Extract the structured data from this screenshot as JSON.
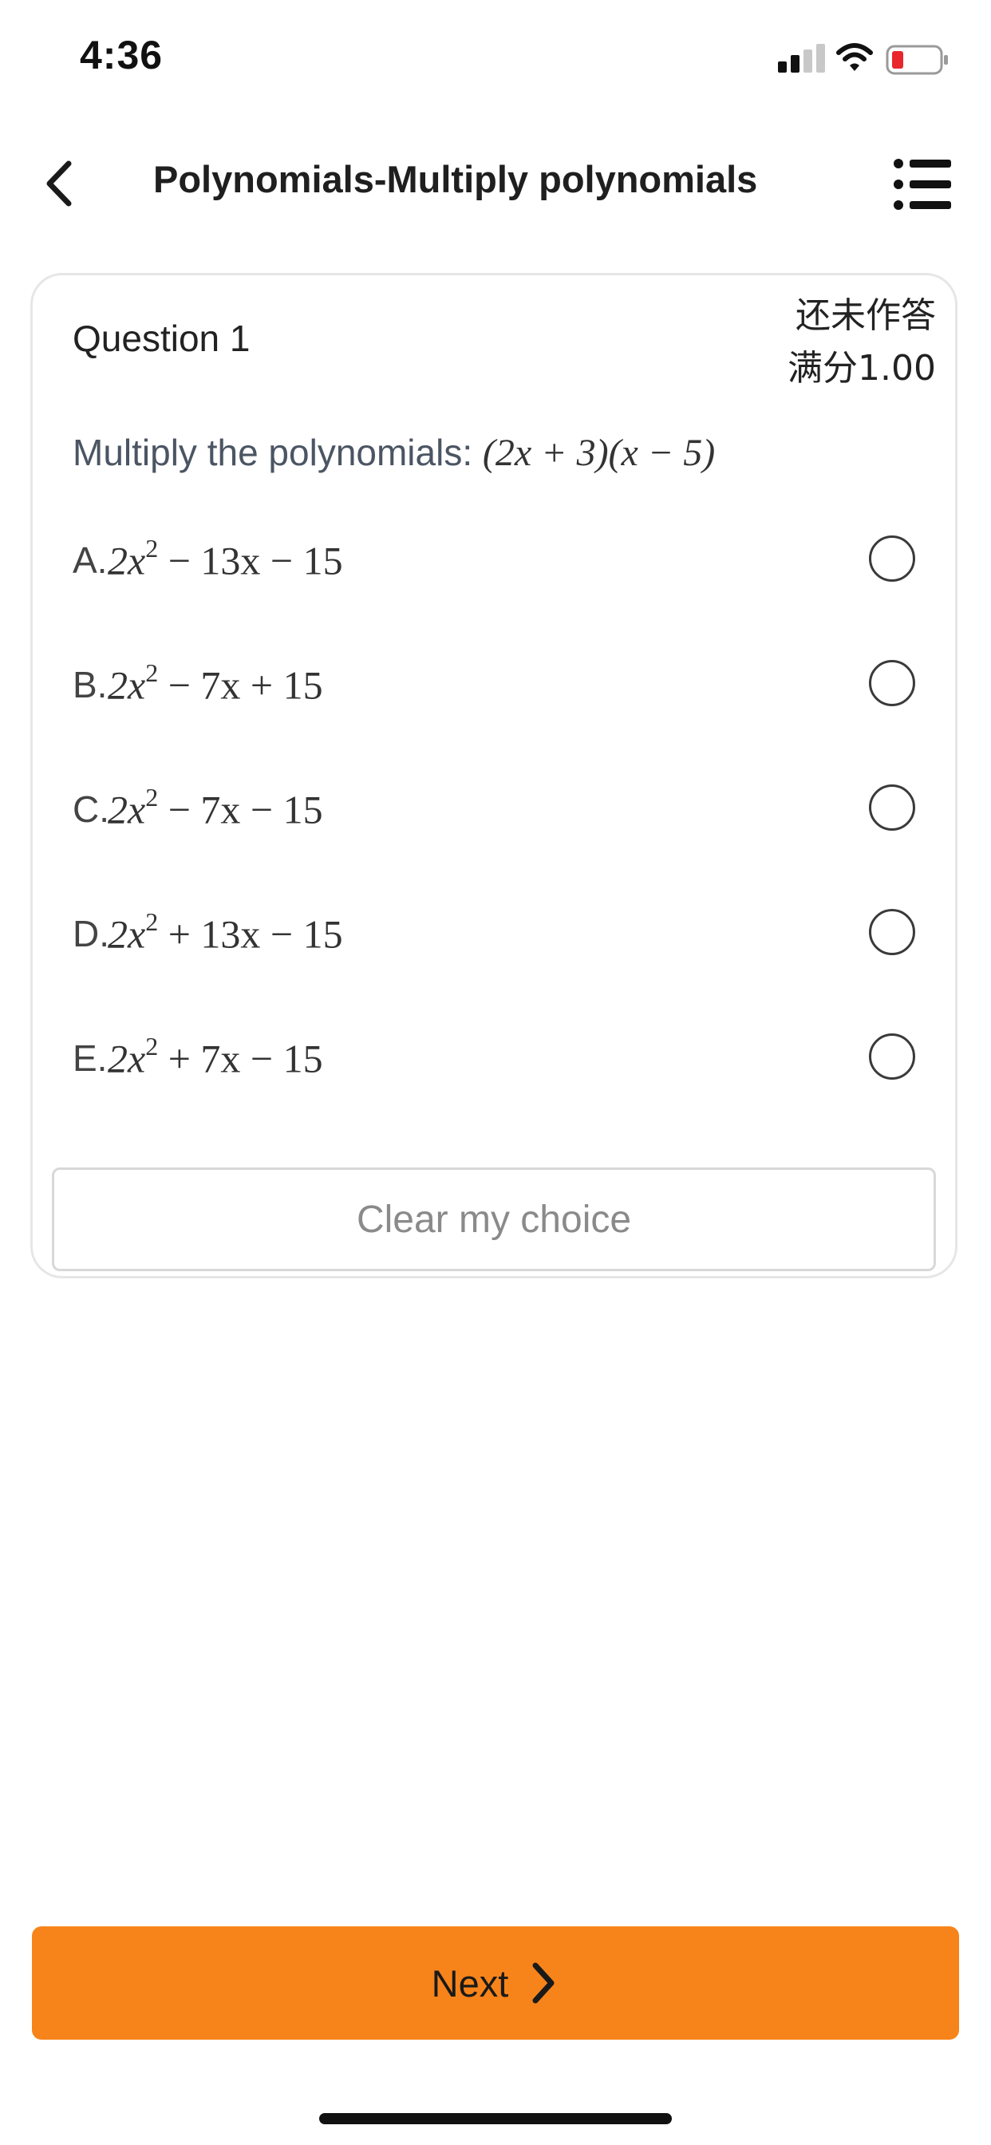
{
  "status_bar": {
    "time": "4:36",
    "icons": [
      "signal-icon",
      "wifi-icon",
      "battery-low-icon"
    ],
    "battery_color": "#e8262b"
  },
  "header": {
    "back_icon": "chevron-left-icon",
    "title": "Polynomials-Multiply polynomials",
    "menu_icon": "list-icon"
  },
  "question": {
    "number_label": "Question 1",
    "status": "还未作答",
    "points": "满分1.00",
    "prompt_text": "Multiply the polynomials: ",
    "prompt_math": "(2x + 3)(x − 5)",
    "options": [
      {
        "letter": "A.",
        "pre": "2x",
        "exp": "2",
        "post": " − 13x − 15",
        "selected": false
      },
      {
        "letter": "B.",
        "pre": "2x",
        "exp": "2",
        "post": " − 7x + 15",
        "selected": false
      },
      {
        "letter": "C.",
        "pre": "2x",
        "exp": "2",
        "post": " − 7x − 15",
        "selected": false
      },
      {
        "letter": "D.",
        "pre": "2x",
        "exp": "2",
        "post": " + 13x − 15",
        "selected": false
      },
      {
        "letter": "E.",
        "pre": "2x",
        "exp": "2",
        "post": " + 7x − 15",
        "selected": false
      }
    ],
    "clear_label": "Clear my choice"
  },
  "footer": {
    "next_label": "Next",
    "next_icon": "chevron-right-icon",
    "accent_color": "#f7841a"
  }
}
